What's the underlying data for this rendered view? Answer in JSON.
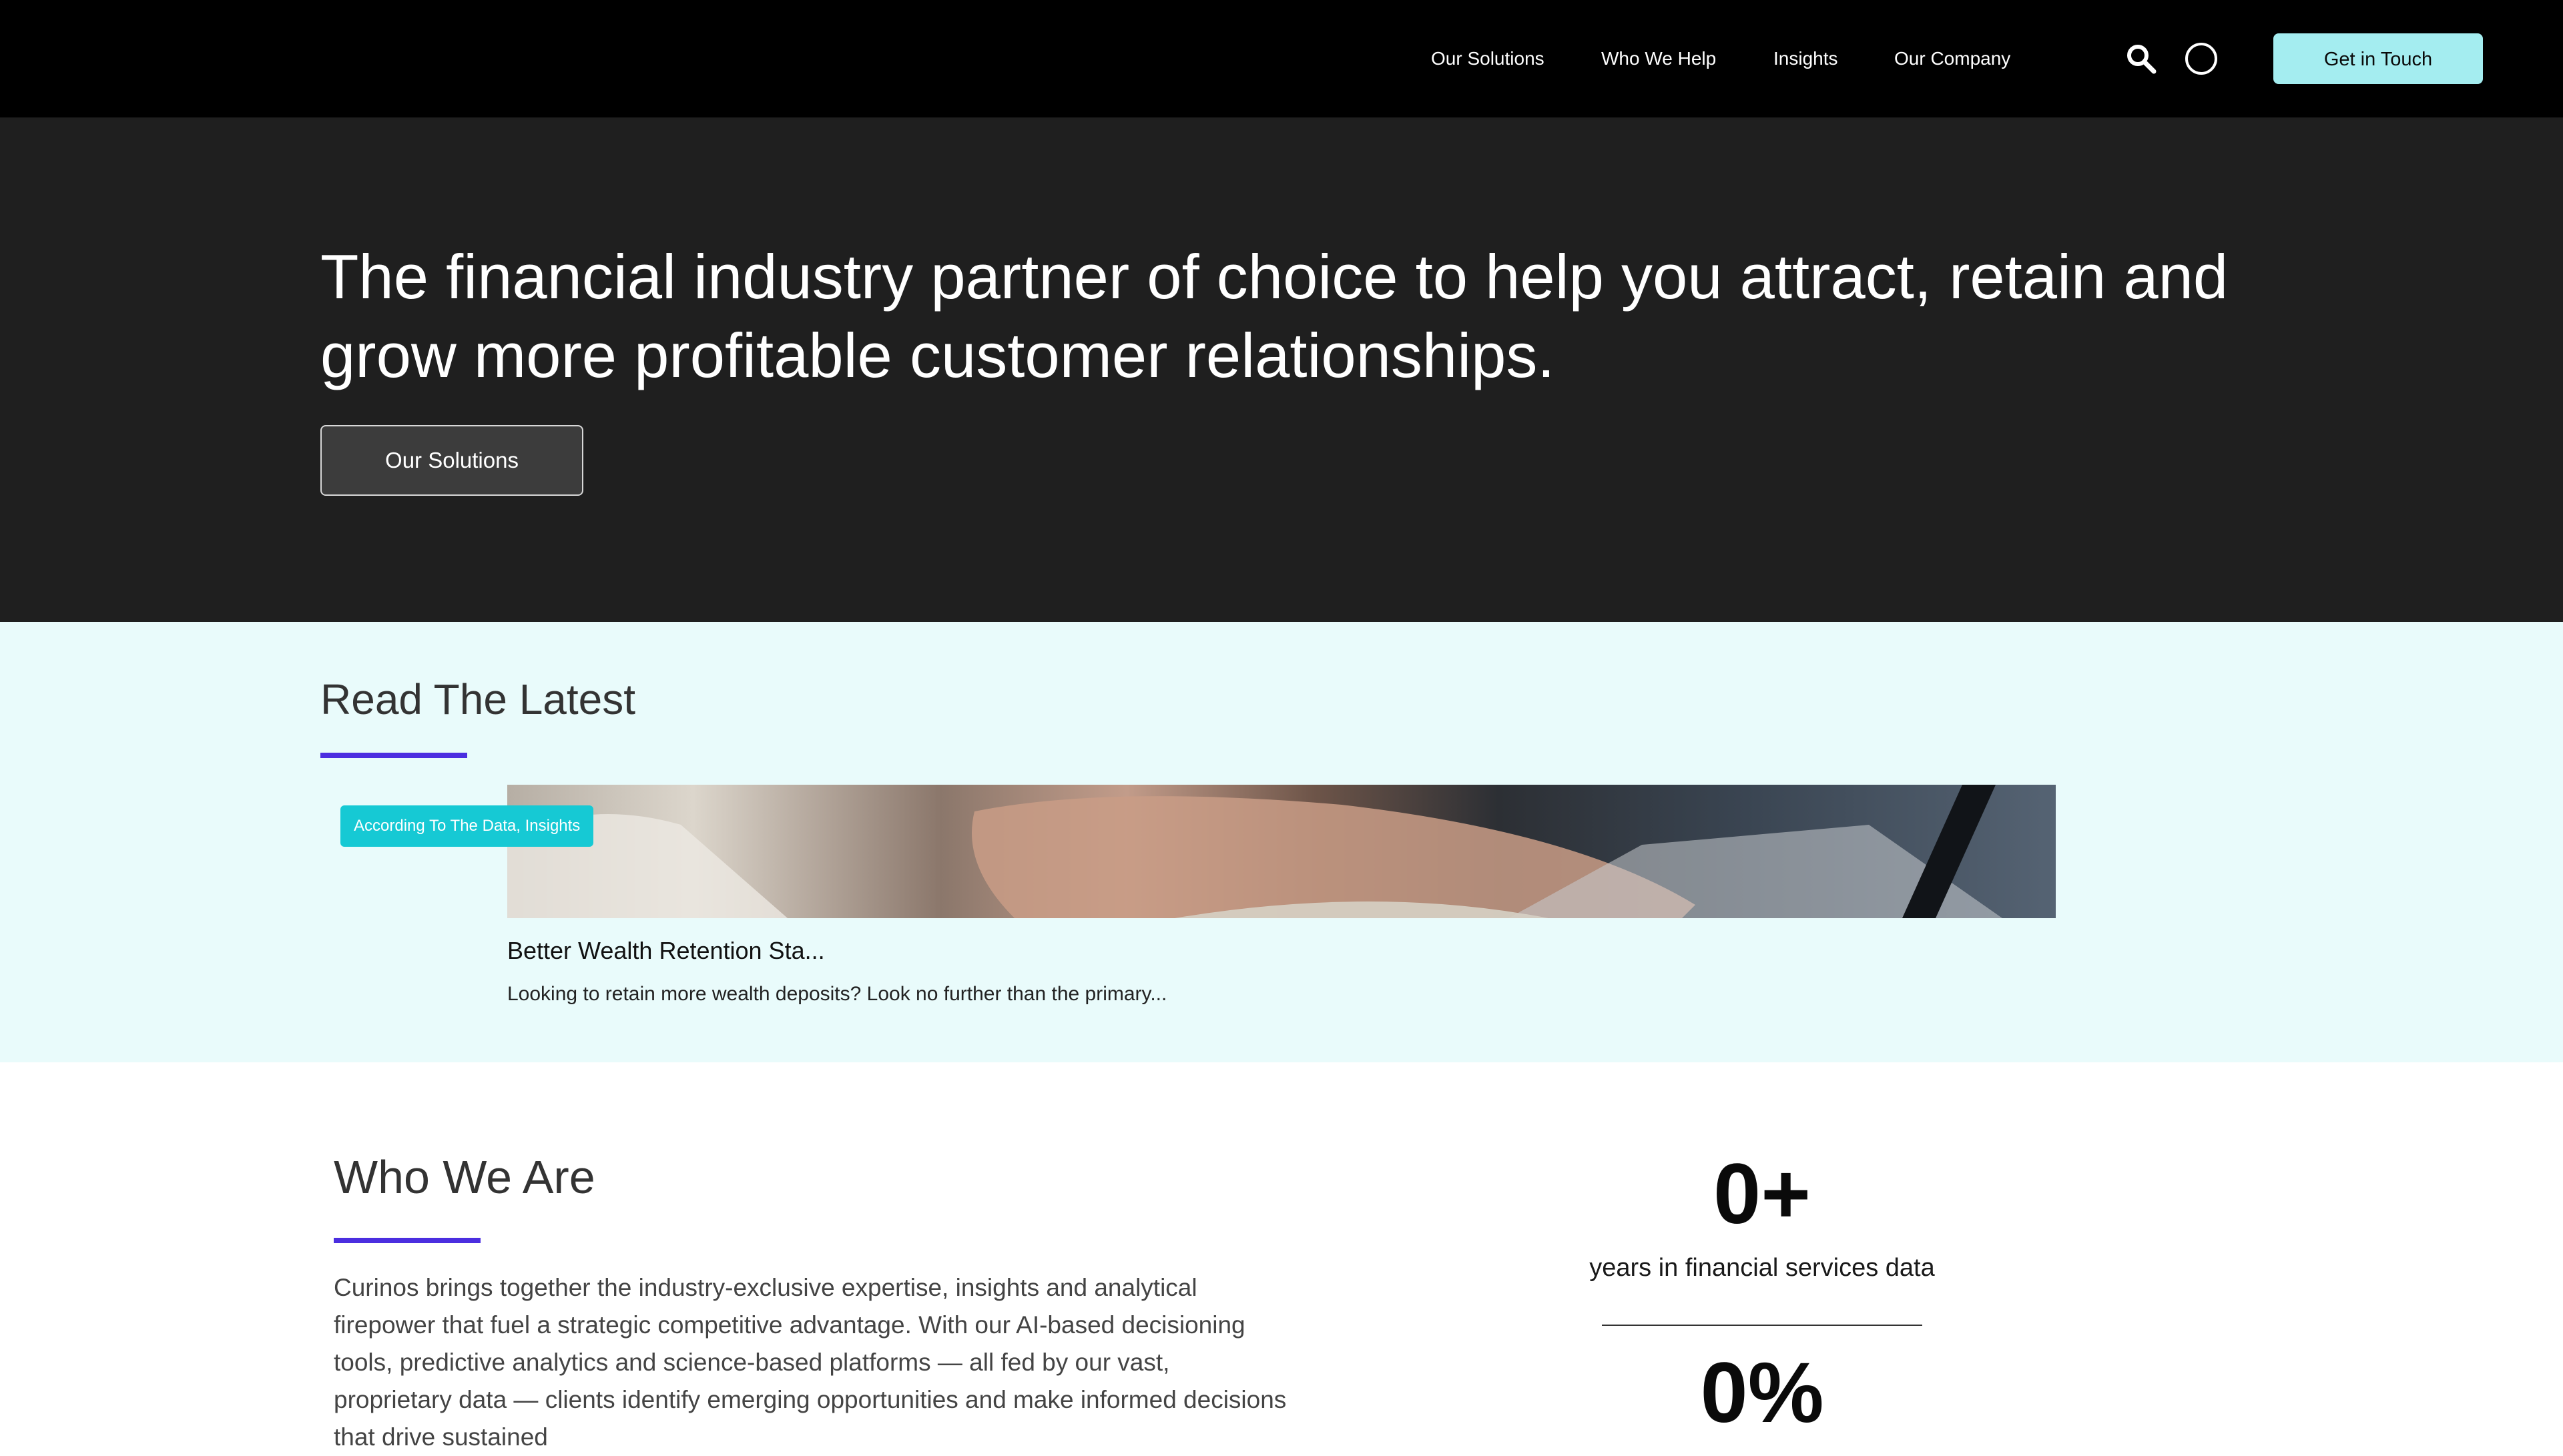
{
  "header": {
    "nav": [
      "Our Solutions",
      "Who We Help",
      "Insights",
      "Our Company"
    ],
    "cta_label": "Get in Touch",
    "icons": [
      "search-icon",
      "theme-toggle-icon"
    ]
  },
  "hero": {
    "title_line1": "The financial industry partner of choice to help you attract, retain and",
    "title_line2": "grow more profitable customer relationships.",
    "button_label": "Our Solutions"
  },
  "latest": {
    "heading": "Read The Latest",
    "card": {
      "tag": "According To The Data, Insights",
      "title": "Better Wealth Retention Sta...",
      "excerpt": "Looking to retain more wealth deposits? Look no further than the primary..."
    }
  },
  "who": {
    "heading": "Who We Are",
    "body": "Curinos brings together the industry-exclusive expertise, insights and analytical firepower that fuel a strategic competitive advantage. With our AI-based decisioning tools, predictive analytics and science-based platforms — all fed by our vast, proprietary data — clients identify emerging opportunities and make informed decisions that drive sustained",
    "stats": [
      {
        "value": "0+",
        "label": "years in financial services data"
      },
      {
        "value": "0%",
        "label": ""
      }
    ]
  },
  "colors": {
    "header_bg": "#000000",
    "hero_bg": "#1f1f1f",
    "accent_cyan": "#a4edf0",
    "tag_cyan": "#16c9d4",
    "underline_purple": "#4b2ee0",
    "latest_bg": "#e9fbfb"
  }
}
